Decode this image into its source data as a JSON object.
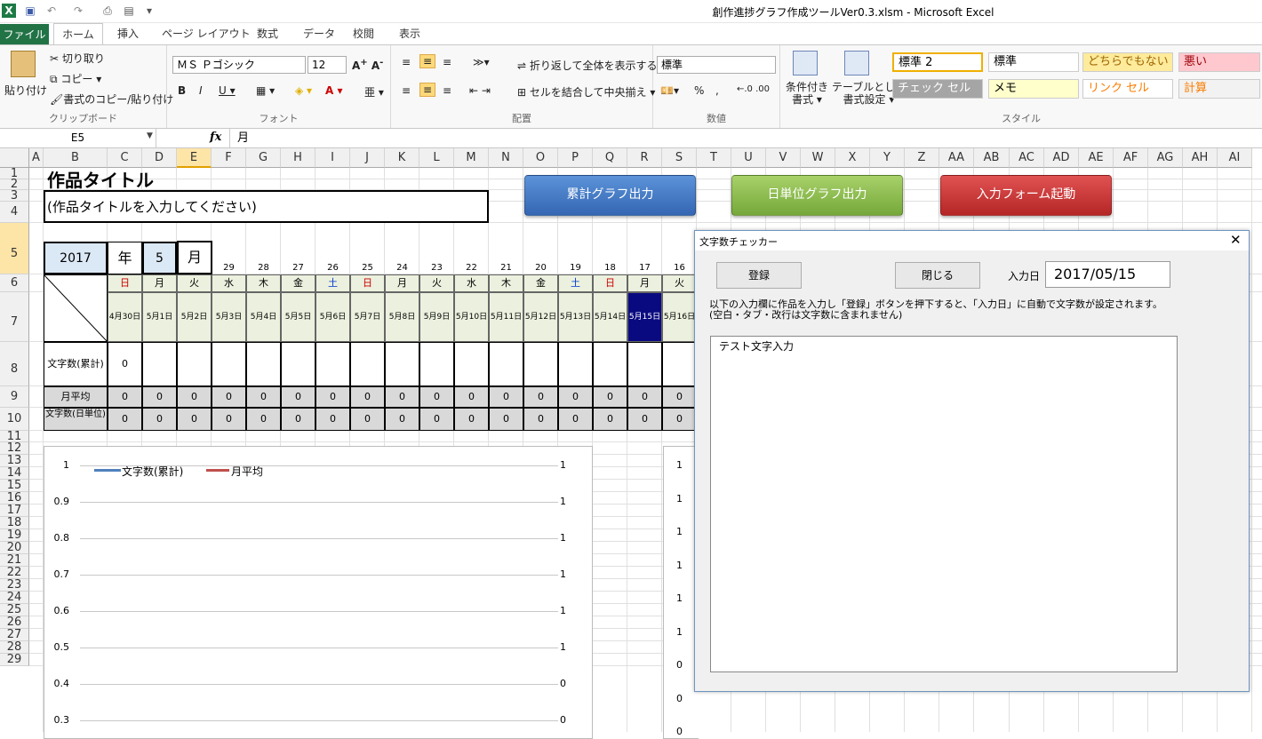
{
  "window": {
    "title": "創作進捗グラフ作成ツールVer0.3.xlsm  -  Microsoft Excel"
  },
  "tabs": [
    "ファイル",
    "ホーム",
    "挿入",
    "ページ レイアウト",
    "数式",
    "データ",
    "校閲",
    "表示"
  ],
  "ribbon": {
    "clipboard": {
      "paste": "貼り付け",
      "cut": "切り取り",
      "copy": "コピー ▾",
      "format_painter": "書式のコピー/貼り付け",
      "label": "クリップボード"
    },
    "font": {
      "name": "ＭＳ Ｐゴシック",
      "size": "12",
      "label": "フォント"
    },
    "alignment": {
      "wrap": "折り返して全体を表示する",
      "merge": "セルを結合して中央揃え ▾",
      "label": "配置"
    },
    "number": {
      "format": "標準",
      "label": "数値"
    },
    "styles": {
      "conditional": "条件付き\n書式 ▾",
      "table": "テーブルとして\n書式設定 ▾",
      "cells": [
        {
          "text": "標準 2",
          "bg": "#ffffff",
          "fg": "#000000"
        },
        {
          "text": "標準",
          "bg": "#ffffff",
          "fg": "#000000"
        },
        {
          "text": "どちらでもない",
          "bg": "#ffeb9c",
          "fg": "#9c6500"
        },
        {
          "text": "悪い",
          "bg": "#ffc7ce",
          "fg": "#9c0006"
        },
        {
          "text": "チェック セル",
          "bg": "#a5a5a5",
          "fg": "#ffffff"
        },
        {
          "text": "メモ",
          "bg": "#ffffcc",
          "fg": "#000000"
        },
        {
          "text": "リンク セル",
          "bg": "#ffffff",
          "fg": "#fa7d00"
        },
        {
          "text": "計算",
          "bg": "#f2f2f2",
          "fg": "#fa7d00"
        }
      ],
      "label": "スタイル"
    }
  },
  "formula_bar": {
    "name_box": "E5",
    "fx": "fx",
    "value": "月"
  },
  "columns": [
    "A",
    "B",
    "C",
    "D",
    "E",
    "F",
    "G",
    "H",
    "I",
    "J",
    "K",
    "L",
    "M",
    "N",
    "O",
    "P",
    "Q",
    "R",
    "S",
    "T",
    "U",
    "V",
    "W",
    "X",
    "Y",
    "Z",
    "AA",
    "AB",
    "AC",
    "AD",
    "AE",
    "AF",
    "AG",
    "AH",
    "AI"
  ],
  "rows": [
    "1",
    "2",
    "3",
    "4",
    "5",
    "6",
    "7",
    "8",
    "9",
    "10",
    "11",
    "12",
    "13",
    "14",
    "15",
    "16",
    "17",
    "18",
    "19",
    "20",
    "21",
    "22",
    "23",
    "24",
    "25",
    "26",
    "27",
    "28",
    "29"
  ],
  "sheet": {
    "title": "作品タイトル",
    "title_input": "(作品タイトルを入力してください)",
    "year": "2017",
    "year_label": "年",
    "month": "5",
    "month_label": "月",
    "day_numbers": [
      "29",
      "28",
      "27",
      "26",
      "25",
      "24",
      "23",
      "22",
      "21",
      "20",
      "19",
      "18",
      "17",
      "16"
    ],
    "weekdays": [
      "日",
      "月",
      "火",
      "水",
      "木",
      "金",
      "土",
      "日",
      "月",
      "火",
      "水",
      "木",
      "金",
      "土",
      "日",
      "月",
      "火"
    ],
    "dates": [
      "4月30日",
      "5月1日",
      "5月2日",
      "5月3日",
      "5月4日",
      "5月5日",
      "5月6日",
      "5月7日",
      "5月8日",
      "5月9日",
      "5月10日",
      "5月11日",
      "5月12日",
      "5月13日",
      "5月14日",
      "5月15日",
      "5月16日"
    ],
    "row_labels": {
      "cumulative": "文字数(累計)",
      "monthly_avg": "月平均",
      "daily": "文字数(日単位)"
    },
    "cumulative_first": "0",
    "zero": "0"
  },
  "buttons": {
    "cumulative": "累計グラフ出力",
    "daily": "日単位グラフ出力",
    "form": "入力フォーム起動"
  },
  "chart1": {
    "legend": [
      "文字数(累計)",
      "月平均"
    ],
    "left_ticks": [
      "1",
      "0.9",
      "0.8",
      "0.7",
      "0.6",
      "0.5",
      "0.4",
      "0.3"
    ],
    "right_ticks": [
      "1",
      "1",
      "1",
      "1",
      "1",
      "1",
      "0",
      "0"
    ]
  },
  "chart2": {
    "left_ticks": [
      "1",
      "1",
      "1",
      "1",
      "1",
      "1",
      "0",
      "0",
      "0"
    ]
  },
  "dialog": {
    "title": "文字数チェッカー",
    "register": "登録",
    "close": "閉じる",
    "date_label": "入力日",
    "date_value": "2017/05/15",
    "instructions": "以下の入力欄に作品を入力し「登録」ボタンを押下すると、「入力日」に自動で文字数が設定されます。",
    "note": "(空白・タブ・改行は文字数に含まれません)",
    "textarea": "テスト文字入力"
  },
  "chart_data": {
    "type": "line",
    "series": [
      {
        "name": "文字数(累計)",
        "values": []
      },
      {
        "name": "月平均",
        "values": []
      }
    ],
    "ylim": [
      0.3,
      1
    ]
  }
}
